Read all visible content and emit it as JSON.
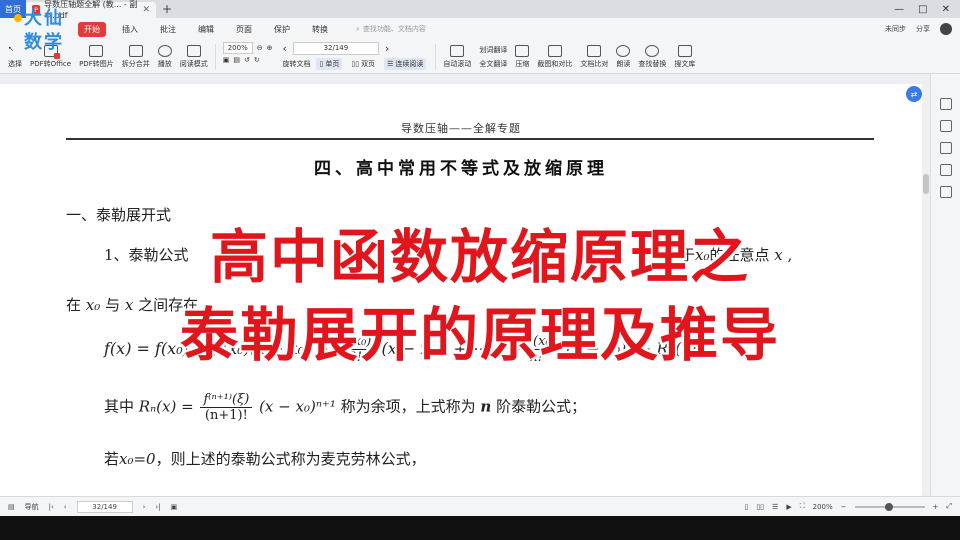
{
  "logo": {
    "line1": "大仙",
    "line2": "数学"
  },
  "tabs": {
    "home": "首页",
    "doc_title": "导数压轴题全解 (教... - 副本.pdf"
  },
  "window": {
    "min": "—",
    "max": "□",
    "close": "✕"
  },
  "menu": {
    "items": [
      "开始",
      "插入",
      "批注",
      "编辑",
      "页面",
      "保护",
      "转换"
    ],
    "active": "开始",
    "search_placeholder": "查找功能、文档内容",
    "right": [
      "未同步",
      "分享"
    ]
  },
  "toolbar": {
    "left_buttons": [
      "选择",
      "PDF转Office",
      "PDF转图片",
      "拆分合并",
      "播放",
      "阅读模式"
    ],
    "zoom": "200%",
    "page": "32/149",
    "rotate": "旋转文档",
    "views": [
      "单页",
      "双页",
      "连续阅读"
    ],
    "right_buttons": [
      "自动滚动",
      "全文翻译",
      "压缩",
      "截图和对比",
      "文档比对",
      "朗读",
      "查找替换",
      "搜文库"
    ],
    "translate_label": "划词翻译"
  },
  "document": {
    "header": "导数压轴——全解专题",
    "section_title": "四、高中常用不等式及放缩原理",
    "subhead": "一、泰勒展开式",
    "line1_left": "1、泰勒公式",
    "line1_right_a": "于",
    "line1_right_b": "的任意点",
    "line2_left": "在",
    "line2_mid": "与",
    "line2_right": "之间存在",
    "formula_lhs": "f(x) = f(x₀) + f′(x₀)(x − x₀) +",
    "formula_frac1_num": "f″(x₀)",
    "formula_frac1_den": "2!",
    "formula_mid": "(x − x₀)² + ⋯ +",
    "formula_frac2_num": "f⁽ⁿ⁾(x₀)",
    "formula_frac2_den": "n!",
    "formula_tail": "(x − x₀)ⁿ + Rₙ(x) ,",
    "remainder_prefix": "其中",
    "remainder_lhs": "Rₙ(x) =",
    "remainder_num": "f⁽ⁿ⁺¹⁾(ξ)",
    "remainder_den": "(n+1)!",
    "remainder_rhs": "(x − x₀)ⁿ⁺¹",
    "remainder_suffix": "称为余项，上式称为",
    "remainder_n": "n",
    "remainder_end": "阶泰勒公式；",
    "maclaurin_prefix": "若",
    "maclaurin_cond": "x₀=0",
    "maclaurin_text": "，则上述的泰勒公式称为麦克劳林公式，"
  },
  "overlay": {
    "title1": "高中函数放缩原理之",
    "title2": "泰勒展开的原理及推导"
  },
  "status": {
    "nav_label": "导航",
    "page": "32/149",
    "zoom": "200%"
  }
}
